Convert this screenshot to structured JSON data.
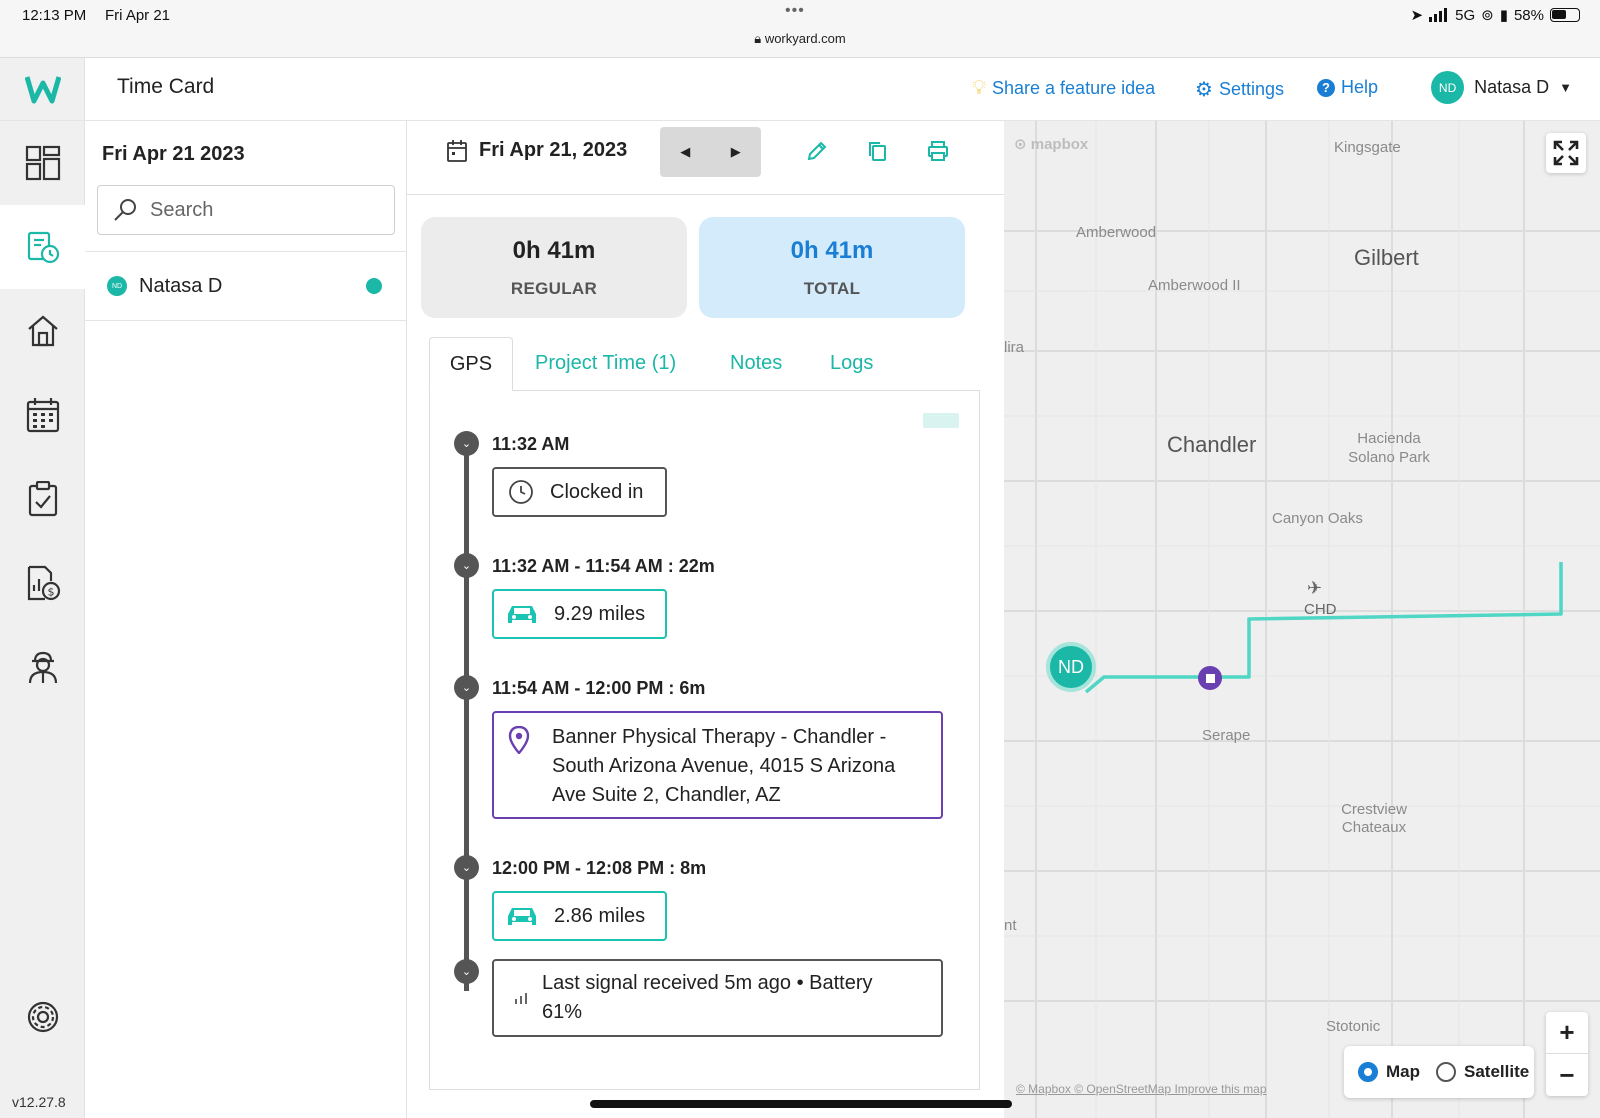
{
  "status_bar": {
    "time": "12:13 PM",
    "date": "Fri Apr 21",
    "dots": "•••",
    "url": "workyard.com",
    "network": "5G",
    "battery": "58%",
    "battery_level": 0.58
  },
  "rail": {
    "logo": "W",
    "items": [
      {
        "name": "dashboard-icon",
        "active": false
      },
      {
        "name": "time-card-icon",
        "active": true
      },
      {
        "name": "home-icon",
        "active": false
      },
      {
        "name": "calendar-icon",
        "active": false
      },
      {
        "name": "clipboard-check-icon",
        "active": false
      },
      {
        "name": "report-cost-icon",
        "active": false
      },
      {
        "name": "worker-icon",
        "active": false
      }
    ],
    "settings_icon": "gear-icon",
    "version": "v12.27.8"
  },
  "header": {
    "title": "Time Card",
    "share_idea": "Share a feature idea",
    "settings": "Settings",
    "help": "Help",
    "user_initials": "ND",
    "user_name": "Natasa D",
    "link_color": "#1a7fd4"
  },
  "list": {
    "date": "Fri Apr 21 2023",
    "search_placeholder": "Search",
    "employees": [
      {
        "initials": "ND",
        "name": "Natasa D",
        "status": "active"
      }
    ]
  },
  "card": {
    "date": "Fri Apr 21, 2023",
    "stats": {
      "regular_value": "0h 41m",
      "regular_label": "REGULAR",
      "total_value": "0h 41m",
      "total_label": "TOTAL"
    },
    "tabs": [
      "GPS",
      "Project Time (1)",
      "Notes",
      "Logs"
    ],
    "active_tab": "GPS",
    "timeline": [
      {
        "label": "11:32 AM",
        "box": "Clocked in",
        "type": "clock"
      },
      {
        "label": "11:32 AM - 11:54 AM : 22m",
        "box": "9.29 miles",
        "type": "drive"
      },
      {
        "label": "11:54 AM - 12:00 PM : 6m",
        "box": "Banner Physical Therapy - Chandler - South Arizona Avenue, 4015 S Arizona Ave Suite 2, Chandler, AZ",
        "type": "location"
      },
      {
        "label": "12:00 PM - 12:08 PM : 8m",
        "box": "2.86 miles",
        "type": "drive"
      },
      {
        "label": "",
        "box": "Last signal received 5m ago • Battery 61%",
        "type": "signal"
      }
    ],
    "accent": "#1bb7a7",
    "location_color": "#6a3fb0"
  },
  "map": {
    "brand": "mapbox",
    "labels": {
      "kingsgate": "Kingsgate",
      "amberwood": "Amberwood",
      "amberwood2": "Amberwood II",
      "gilbert": "Gilbert",
      "chandler": "Chandler",
      "hacienda": "Hacienda Solano Park",
      "canyon": "Canyon Oaks",
      "chd": "CHD",
      "serape": "Serape",
      "crestview": "Crestview Chateaux",
      "stotonic": "Stotonic",
      "ira": "lira",
      "nt": "nt"
    },
    "marker_initials": "ND",
    "attribution": {
      "mapbox": "© Mapbox",
      "osm": "© OpenStreetMap",
      "improve": "Improve this map"
    },
    "layer_options": [
      "Map",
      "Satellite"
    ],
    "selected_layer": "Map",
    "route_color": "#4fd6c5"
  }
}
